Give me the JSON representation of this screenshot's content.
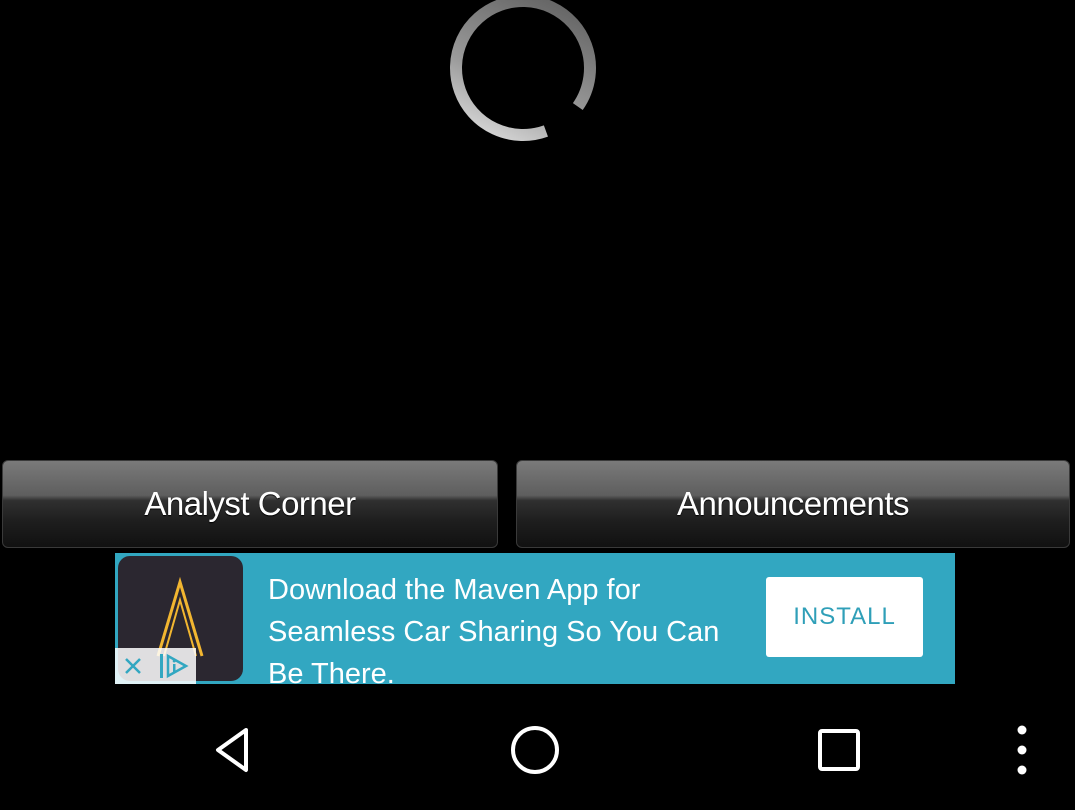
{
  "loading": {
    "icon": "spinner-icon"
  },
  "buttons": {
    "analyst_corner": "Analyst Corner",
    "announcements": "Announcements"
  },
  "ad": {
    "headline": "Download the Maven App for Seamless Car Sharing So You Can Be There.",
    "install_label": "INSTALL",
    "logo_icon": "maven-logo-icon",
    "close_icon": "close-icon",
    "adchoices_icon": "adchoices-icon",
    "background_color": "#32a7c1",
    "logo_color": "#f2b630"
  },
  "navbar": {
    "back_icon": "back-icon",
    "home_icon": "home-icon",
    "recents_icon": "recents-icon",
    "menu_icon": "more-vert-icon"
  }
}
